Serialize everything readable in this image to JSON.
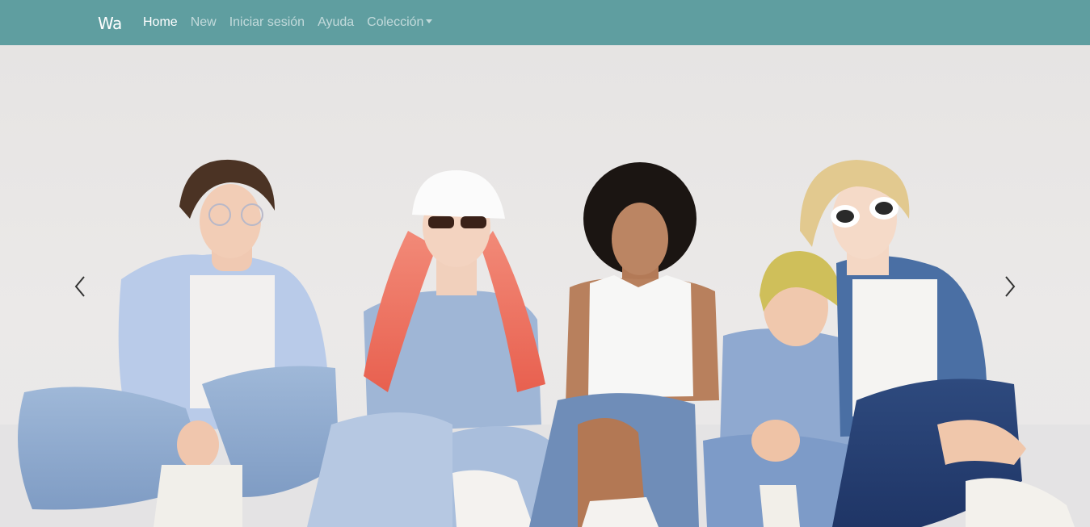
{
  "navbar": {
    "brand": "Wa",
    "background": "#5f9ea0",
    "links": [
      {
        "label": "Home",
        "active": true
      },
      {
        "label": "New",
        "active": false
      },
      {
        "label": "Iniciar sesión",
        "active": false
      },
      {
        "label": "Ayuda",
        "active": false
      },
      {
        "label": "Colección",
        "active": false,
        "dropdown": true
      }
    ]
  },
  "carousel": {
    "prev_icon": "chevron-left-icon",
    "next_icon": "chevron-right-icon"
  }
}
